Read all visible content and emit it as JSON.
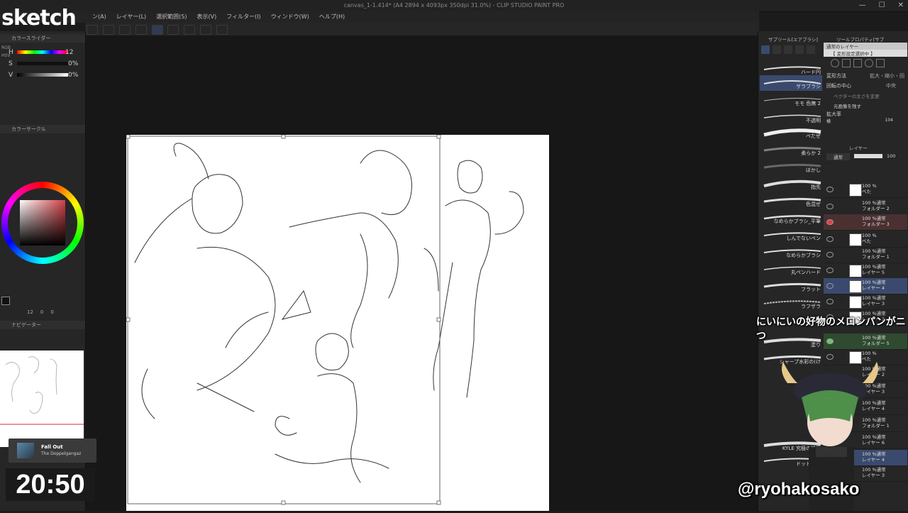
{
  "overlay": {
    "title": "sketch",
    "timer": "20:50",
    "subtitle": "にいにいの好物のメロンパンがニつ",
    "handle": "@ryohakosako",
    "music": {
      "track": "Fall Out",
      "artist": "The Doppelgangaz"
    }
  },
  "window": {
    "title": "canvas_1-1.414* (A4 2894 x 4093px 350dpi 31.0%) - CLIP STUDIO PAINT PRO",
    "controls": [
      "—",
      "☐",
      "✕"
    ]
  },
  "menu": [
    "ン(A)",
    "レイヤー(L)",
    "選択範囲(S)",
    "表示(V)",
    "フィルター(I)",
    "ウィンドウ(W)",
    "ヘルプ(H)"
  ],
  "color_slider": {
    "panel_title": "カラースライダー",
    "mode_tabs": [
      "RGB",
      "HSV"
    ],
    "rows": [
      {
        "label": "H",
        "value": "12"
      },
      {
        "label": "S",
        "value": "0%"
      },
      {
        "label": "V",
        "value": "0%"
      }
    ]
  },
  "color_circle": {
    "panel_title": "カラーサークル",
    "stats": [
      "12",
      "0",
      "0"
    ]
  },
  "navigator": {
    "panel_title": "ナビゲーター"
  },
  "sub_tool": {
    "tab": "サブツール[エアブラシ]",
    "brushes": [
      "ハード円",
      "ザラブラシ",
      "モモ 色無 2",
      "不透明",
      "ペたぜ",
      "柔らか 2",
      "ぼかし",
      "指先",
      "色混ぜ",
      "なめらかブラシ_平筆",
      "しんでないペン",
      "なめらかブラシ",
      "丸ペンハード",
      "フラット",
      "ラフザラ",
      "塗り",
      "シャープ水彩の(け",
      "KYLE 究極の絵画",
      "ドットペン"
    ]
  },
  "tool_property": {
    "tab": "ツールプロパティ[サブ",
    "header": "通常のレイヤー",
    "sub": "【 変形設定選択中 】",
    "rows": [
      {
        "label": "変形方法",
        "value": "拡大・縮小・回"
      },
      {
        "label": "回転の中心",
        "value": "中央"
      }
    ],
    "checks": [
      "ベクターの太さを変更",
      "元画像を残す"
    ],
    "scale_label": "拡大率",
    "scale_sub": "横",
    "scale_value": "104"
  },
  "layers": {
    "tab": "レイヤー",
    "blend": "通常",
    "opacity": "100",
    "rows": [
      {
        "text": "100 %\nベた"
      },
      {
        "text": "100 %通常\nフォルダー 2"
      },
      {
        "text": "100 %通常\nフォルダー 3"
      },
      {
        "text": "100 %\nベた"
      },
      {
        "text": "100 %通常\nフォルダー 1"
      },
      {
        "text": "100 %通常\nレイヤー 5"
      },
      {
        "text": "100 %通常\nレイヤー 4"
      },
      {
        "text": "100 %通常\nレイヤー 3"
      },
      {
        "text": "100 %通常\nレイヤー 2"
      },
      {
        "text": "100 %通常\nフォルダー 5"
      },
      {
        "text": "100 %\nベた"
      },
      {
        "text": "100 %通常\nレイヤー 2"
      },
      {
        "text": "100 %通常\nレイヤー 3"
      },
      {
        "text": "100 %通常\nレイヤー 4"
      },
      {
        "text": "100 %通常\nフォルダー 1"
      },
      {
        "text": "100 %通常\nレイヤー 6"
      },
      {
        "text": "100 %通常\nレイヤー 4"
      },
      {
        "text": "100 %通常\nレイヤー 3"
      }
    ]
  },
  "colors": {
    "accent_blue": "#3a4a6e",
    "red_tag": "#e0404a",
    "green_tag": "#6fc46f"
  }
}
